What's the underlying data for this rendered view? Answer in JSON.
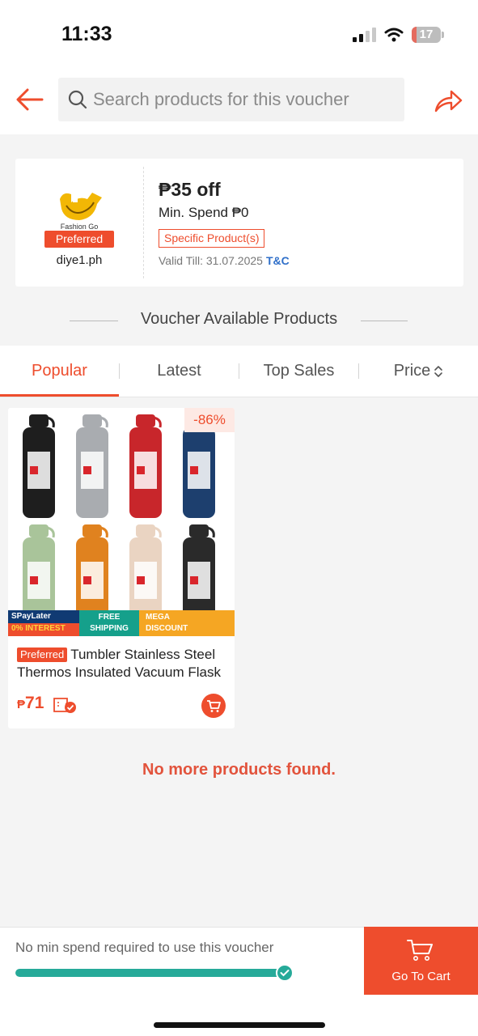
{
  "status_bar": {
    "time": "11:33",
    "battery": "17",
    "battery_level": 0.17
  },
  "header": {
    "search_placeholder": "Search products for this voucher",
    "back_icon": "arrow-left-icon",
    "share_icon": "share-icon"
  },
  "voucher": {
    "shop_logo_text": "Fashion Go",
    "preferred_label": "Preferred",
    "shop_name": "diye1.ph",
    "title": "₱35 off",
    "min_spend": "Min. Spend ₱0",
    "tag": "Specific Product(s)",
    "validity": "Valid Till: 31.07.2025",
    "tc": "T&C"
  },
  "section_heading": "Voucher Available Products",
  "tabs": [
    {
      "label": "Popular",
      "active": true
    },
    {
      "label": "Latest",
      "active": false
    },
    {
      "label": "Top Sales",
      "active": false
    },
    {
      "label": "Price",
      "active": false
    }
  ],
  "product": {
    "discount": "-86%",
    "promo_spaylater_1": "SPayLater",
    "promo_spaylater_2": "0% INTEREST",
    "promo_free_1": "FREE",
    "promo_free_2": "SHIPPING",
    "promo_mega_1": "MEGA",
    "promo_mega_2": "DISCOUNT",
    "badge": "Preferred",
    "title": "Tumbler Stainless Steel Thermos Insulated Vacuum Flask",
    "currency": "₱",
    "price": "71",
    "bottle_colors": [
      "#1e1e1e",
      "#a9acb0",
      "#c8262b",
      "#1d3f6e",
      "#a9c49a",
      "#e0821f",
      "#ead4c2",
      "#2a2a2a"
    ]
  },
  "no_more": "No more products found.",
  "bottom": {
    "message": "No min spend required to use this voucher",
    "progress": 1.0,
    "go_cart_label": "Go To Cart"
  },
  "colors": {
    "primary": "#ee4d2d",
    "teal": "#26aa99",
    "link": "#2f6fc9"
  }
}
